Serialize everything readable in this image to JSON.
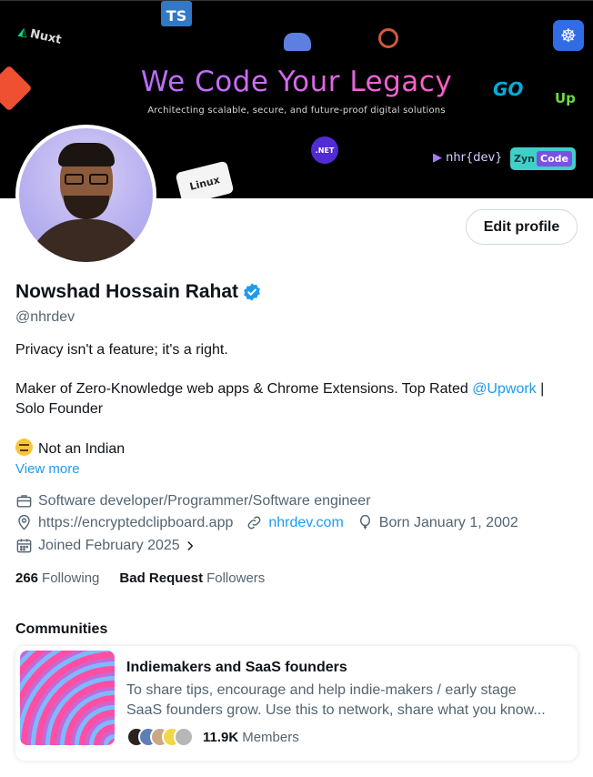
{
  "banner": {
    "title": "We Code Your Legacy",
    "subtitle": "Architecting scalable, secure, and future-proof digital solutions",
    "logos": {
      "ts": "TS",
      "nuxt": "Nuxt",
      "go": "GO",
      "upwork": "Up",
      "net": ".NET",
      "linux": "Linux",
      "nhrdev": "nhr{dev}",
      "zyn_left": "Zyn",
      "zyn_right": "Code"
    }
  },
  "profile": {
    "name": "Nowshad Hossain Rahat",
    "handle": "@nhrdev",
    "edit_label": "Edit profile",
    "bio_line1": "Privacy isn't a feature; it's a right.",
    "bio_line2_prefix": "Maker of Zero-Knowledge web apps & Chrome Extensions. Top Rated ",
    "bio_line2_link": "@Upwork",
    "bio_line2_suffix": " |",
    "bio_line3": "Solo Founder",
    "bio_line4": "Not an Indian",
    "view_more": "View more",
    "profession": "Software developer/Programmer/Software engineer",
    "website_plain": "https://encryptedclipboard.app",
    "website_link": "nhrdev.com",
    "born": "Born January 1, 2002",
    "joined": "Joined February 2025"
  },
  "stats": {
    "following_count": "266",
    "following_label": "Following",
    "followers_count": "Bad Request",
    "followers_label": "Followers"
  },
  "communities": {
    "heading": "Communities",
    "items": [
      {
        "title": "Indiemakers and SaaS founders",
        "desc_line1": "To share tips, encourage and help indie-makers / early stage",
        "desc_line2": "SaaS founders grow. Use this to network, share what you know...",
        "members_count": "11.9K",
        "members_label": "Members"
      }
    ]
  },
  "colors": {
    "accent": "#1d9bf0",
    "text_primary": "#0f1419",
    "text_secondary": "#536471",
    "verified": "#1d9bf0"
  },
  "icons": {
    "profession": "briefcase-icon",
    "location": "location-pin-icon",
    "link": "link-icon",
    "birthday": "balloon-icon",
    "joined": "calendar-icon"
  }
}
